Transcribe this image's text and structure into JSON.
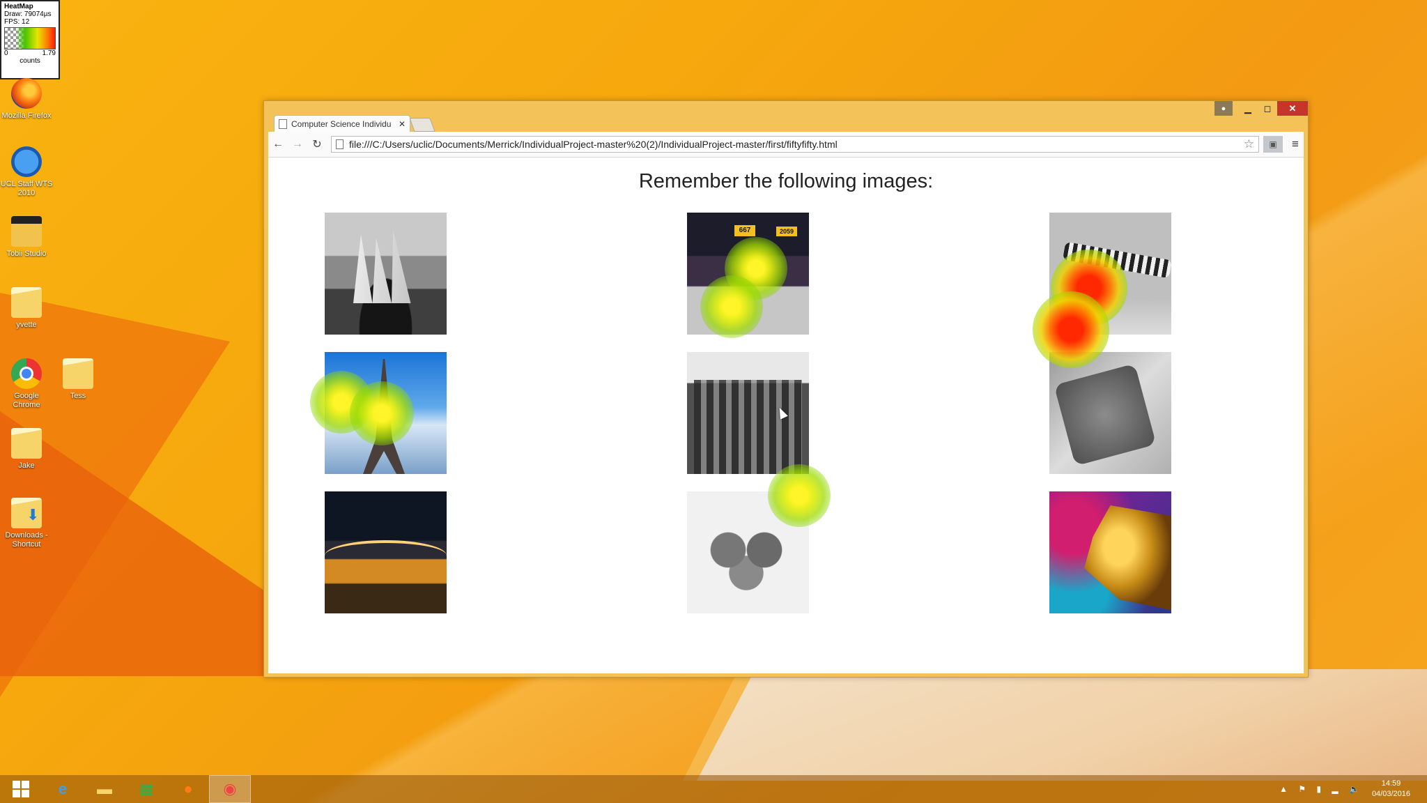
{
  "heatmap_widget": {
    "title": "HeatMap",
    "draw": "Draw: 79074µs",
    "fps": "FPS: 12",
    "min": "0",
    "max": "1.79",
    "unit": "counts"
  },
  "desktop_icons": [
    {
      "label": "Mozilla Firefox",
      "icon": "firefox-icon"
    },
    {
      "label": "UCL Staff WTS 2010",
      "icon": "remote-desktop-icon"
    },
    {
      "label": "Tobii Studio",
      "icon": "tobii-studio-icon"
    },
    {
      "label": "yvette",
      "icon": "folder-icon"
    },
    {
      "label": "Google Chrome",
      "icon": "chrome-icon"
    },
    {
      "label": "Tess",
      "icon": "folder-icon"
    },
    {
      "label": "Jake",
      "icon": "folder-icon"
    },
    {
      "label": "Downloads - Shortcut",
      "icon": "downloads-shortcut-icon"
    }
  ],
  "browser": {
    "tab_title": "Computer Science Individu",
    "url": "file:///C:/Users/uclic/Documents/Merrick/IndividualProject-master%20(2)/IndividualProject-master/first/fiftyfifty.html"
  },
  "page": {
    "heading": "Remember the following images:",
    "images": [
      {
        "subject": "sailing ship (greyscale)"
      },
      {
        "subject": "marathon runners (colour)"
      },
      {
        "subject": "striped pole (greyscale)"
      },
      {
        "subject": "eiffel tower (colour)"
      },
      {
        "subject": "brick building (greyscale)"
      },
      {
        "subject": "toaster (greyscale)"
      },
      {
        "subject": "bridge at night (colour)"
      },
      {
        "subject": "citrus fruit (greyscale)"
      },
      {
        "subject": "golden dragon (colour)"
      }
    ]
  },
  "colors": {
    "desktop": "#f6a70d",
    "window_frame": "#f3c35a",
    "close_button": "#c7352a"
  },
  "taskbar": {
    "items": [
      {
        "icon": "start-icon"
      },
      {
        "icon": "internet-explorer-icon"
      },
      {
        "icon": "file-explorer-icon"
      },
      {
        "icon": "store-icon"
      },
      {
        "icon": "firefox-icon"
      },
      {
        "icon": "chrome-icon",
        "active": true
      }
    ],
    "time": "14:59",
    "date": "04/03/2016"
  }
}
